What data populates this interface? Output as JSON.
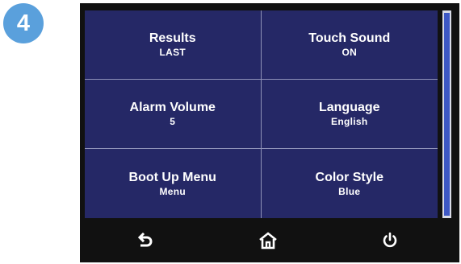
{
  "step_badge": "4",
  "menu": {
    "items": [
      {
        "label": "Results",
        "value": "LAST"
      },
      {
        "label": "Touch Sound",
        "value": "ON"
      },
      {
        "label": "Alarm Volume",
        "value": "5"
      },
      {
        "label": "Language",
        "value": "English"
      },
      {
        "label": "Boot Up Menu",
        "value": "Menu"
      },
      {
        "label": "Color Style",
        "value": "Blue"
      }
    ]
  },
  "nav": {
    "icons": [
      "back-icon",
      "home-icon",
      "power-icon"
    ]
  },
  "colors": {
    "screen_bg": "#252866",
    "device_bezel": "#111111",
    "badge": "#5aa0dc",
    "scroll_thumb": "#3e58c5",
    "divider": "#8f92b8"
  }
}
